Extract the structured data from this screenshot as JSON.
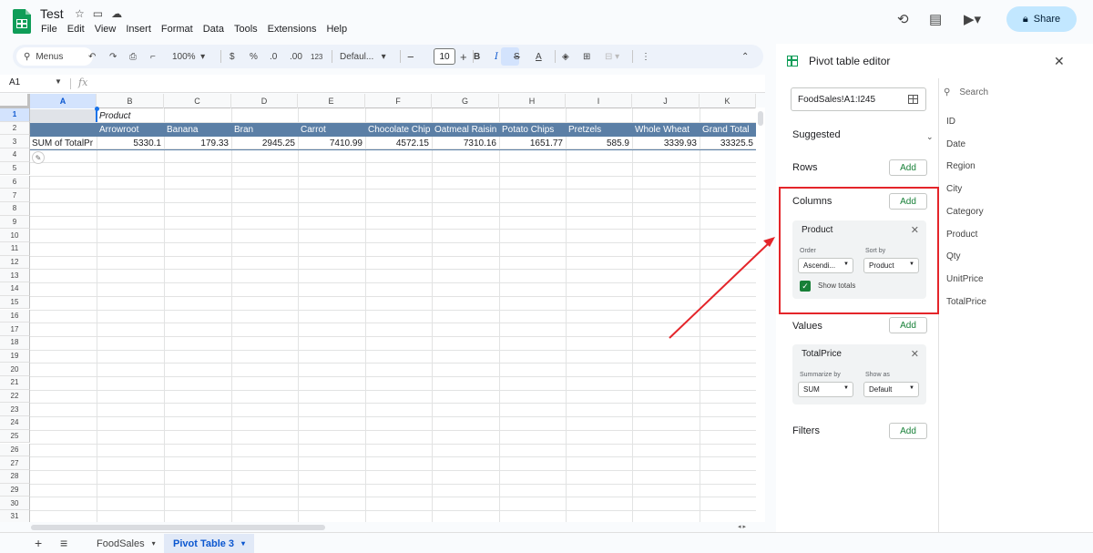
{
  "app": {
    "title": "Test",
    "menu": [
      "File",
      "Edit",
      "View",
      "Insert",
      "Format",
      "Data",
      "Tools",
      "Extensions",
      "Help"
    ],
    "share_label": "Share",
    "accent": "#c2e7ff",
    "brand": "#0f9d58"
  },
  "toolbar": {
    "menus_label": "Menus",
    "zoom": "100%",
    "currency": "$",
    "percent": "%",
    "dec_decrease": ".0",
    "dec_increase": ".00",
    "number_format": "123",
    "font": "Defaul...",
    "font_size": "10",
    "bold": "B",
    "italic": "I",
    "strike": "S",
    "text_color": "A"
  },
  "formula_bar": {
    "cell_ref": "A1",
    "fx": "fx"
  },
  "sheet": {
    "columns": [
      "A",
      "B",
      "C",
      "D",
      "E",
      "F",
      "G",
      "H",
      "I",
      "J",
      "K"
    ],
    "rows": [
      "1",
      "2",
      "3",
      "4",
      "5",
      "6",
      "7",
      "8",
      "9",
      "10",
      "11",
      "12",
      "13",
      "14",
      "15",
      "16",
      "17",
      "18",
      "19",
      "20",
      "21",
      "22",
      "23",
      "24",
      "25",
      "26",
      "27",
      "28",
      "29",
      "30",
      "31"
    ],
    "pivot_label": "Product",
    "product_headers": [
      "Arrowroot",
      "Banana",
      "Bran",
      "Carrot",
      "Chocolate Chip",
      "Oatmeal Raisin",
      "Potato Chips",
      "Pretzels",
      "Whole Wheat",
      "Grand Total"
    ],
    "row_label": "SUM of TotalPr",
    "values": [
      "5330.1",
      "179.33",
      "2945.25",
      "7410.99",
      "4572.15",
      "7310.16",
      "1651.77",
      "585.9",
      "3339.93",
      "33325.5"
    ]
  },
  "tabs": {
    "sheets": [
      "FoodSales",
      "Pivot Table 3"
    ],
    "active": "Pivot Table 3"
  },
  "panel": {
    "title": "Pivot table editor",
    "range": "FoodSales!A1:I245",
    "suggested_label": "Suggested",
    "rows_label": "Rows",
    "columns_label": "Columns",
    "values_label": "Values",
    "filters_label": "Filters",
    "add_label": "Add",
    "column_card": {
      "title": "Product",
      "order_label": "Order",
      "order_value": "Ascendi...",
      "sort_label": "Sort by",
      "sort_value": "Product",
      "show_totals": "Show totals"
    },
    "value_card": {
      "title": "TotalPrice",
      "summarize_label": "Summarize by",
      "summarize_value": "SUM",
      "show_as_label": "Show as",
      "show_as_value": "Default"
    },
    "search_placeholder": "Search",
    "fields": [
      "ID",
      "Date",
      "Region",
      "City",
      "Category",
      "Product",
      "Qty",
      "UnitPrice",
      "TotalPrice"
    ]
  }
}
